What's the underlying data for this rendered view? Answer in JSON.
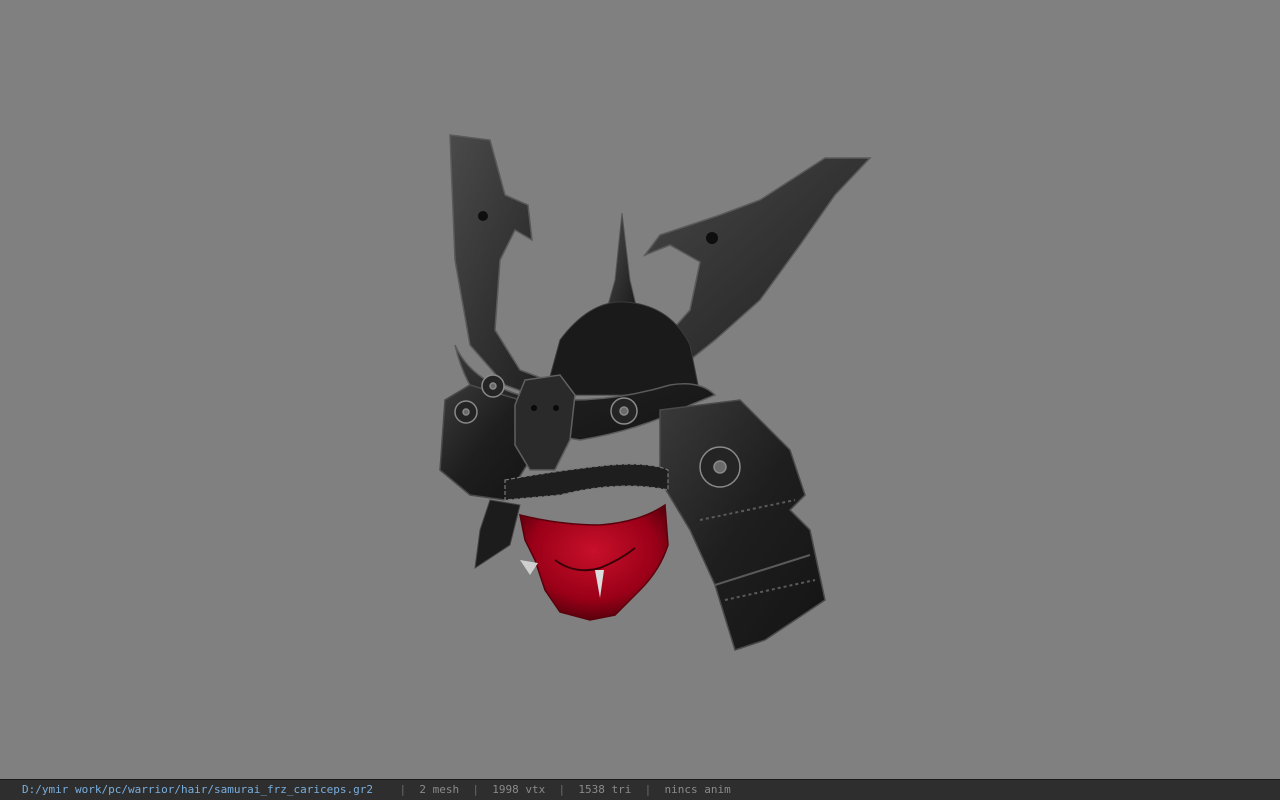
{
  "viewport": {
    "background": "#808080",
    "model_name": "samurai helmet with red oni mask"
  },
  "status_bar": {
    "file_path": "D:/ymir work/pc/warrior/hair/samurai_frz_cariceps.gr2",
    "separator": "|",
    "mesh_count": "2 mesh",
    "vertex_count": "1998 vtx",
    "triangle_count": "1538 tri",
    "anim_status": "nincs anim",
    "path_color": "#78aede",
    "text_color": "#8a8a8a"
  }
}
